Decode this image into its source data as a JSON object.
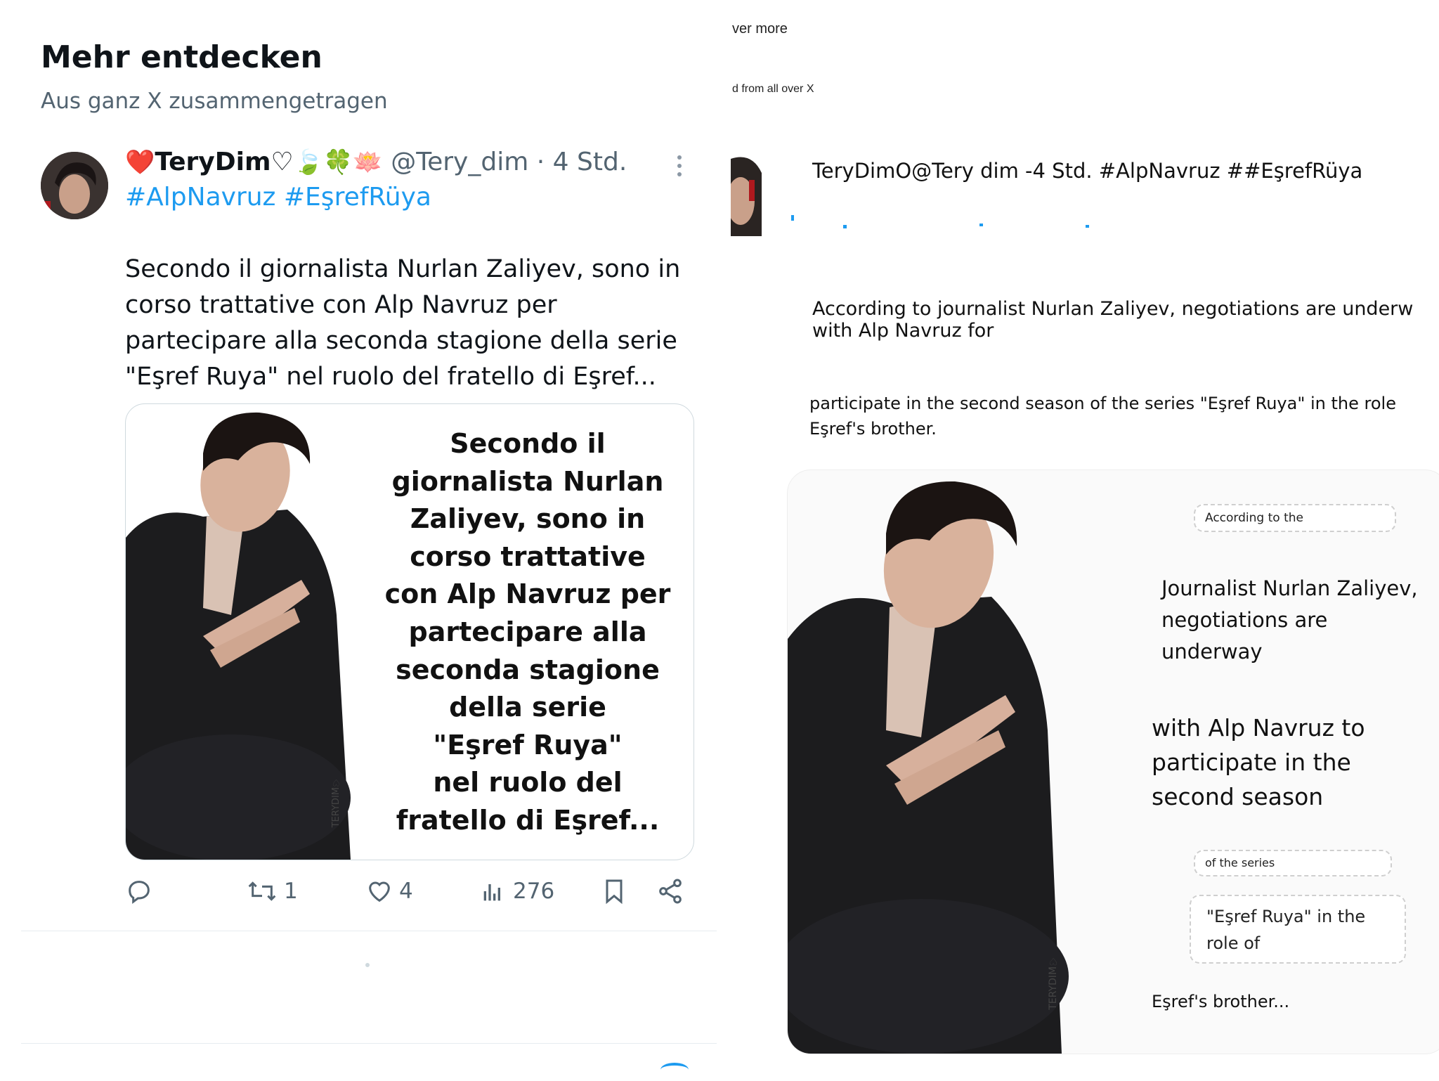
{
  "left": {
    "heading": "Mehr entdecken",
    "subheading": "Aus ganz X zusammengetragen",
    "tweet": {
      "emoji_prefix": "❤️",
      "display_name": "TeryDim♡",
      "emoji_suffix": "🍃🍀🪷",
      "handle": "@Tery_dim",
      "separator": "·",
      "time": "4 Std.",
      "hashtags": "#AlpNavruz #EşrefRüya",
      "text": "Secondo il giornalista Nurlan Zaliyev, sono in corso trattative con Alp Navruz per partecipare alla seconda stagione della serie \"Eşref Ruya\" nel ruolo del fratello di Eşref...",
      "image_overlay_lines": [
        "Secondo il",
        "giornalista Nurlan",
        "Zaliyev, sono in",
        "corso trattative",
        "con Alp Navruz per",
        "partecipare alla",
        "seconda stagione",
        "della serie",
        "\"Eşref Ruya\"",
        "nel ruolo del",
        "fratello di Eşref..."
      ],
      "watermark": "TERYDIM♡",
      "actions": {
        "reply_icon": "reply-icon",
        "retweet_icon": "retweet-icon",
        "retweets": "1",
        "like_icon": "heart-icon",
        "likes": "4",
        "views_icon": "views-icon",
        "views": "276",
        "bookmark_icon": "bookmark-icon",
        "share_icon": "share-icon"
      }
    }
  },
  "right": {
    "top_fragment_1": "ver more",
    "top_fragment_2": "d from all over X",
    "meta": "TeryDimO@Tery dim -4 Std. #AlpNavruz ##EşrefRüya",
    "para1_line1": "According to journalist Nurlan Zaliyev, negotiations are underw",
    "para1_line2": "with Alp Navruz for",
    "para2_line1": "participate in the second season of the series \"Eşref Ruya\" in the role",
    "para2_line2": "Eşref's brother.",
    "card": {
      "box1": "According to the",
      "text1_lines": [
        "Journalist Nurlan Zaliyev,",
        "negotiations are",
        "underway"
      ],
      "text2_lines": [
        "with Alp Navruz to",
        "participate in the",
        "second season"
      ],
      "box2": "of the series",
      "box3_lines": [
        "\"Eşref Ruya\" in the",
        "role of"
      ],
      "text3": "Eşref's brother...",
      "watermark": "TERYDIM♡"
    }
  },
  "colors": {
    "accent": "#1d9bf0",
    "secondary_text": "#536471",
    "primary_text": "#0f1419",
    "divider": "#e6ecf0"
  }
}
